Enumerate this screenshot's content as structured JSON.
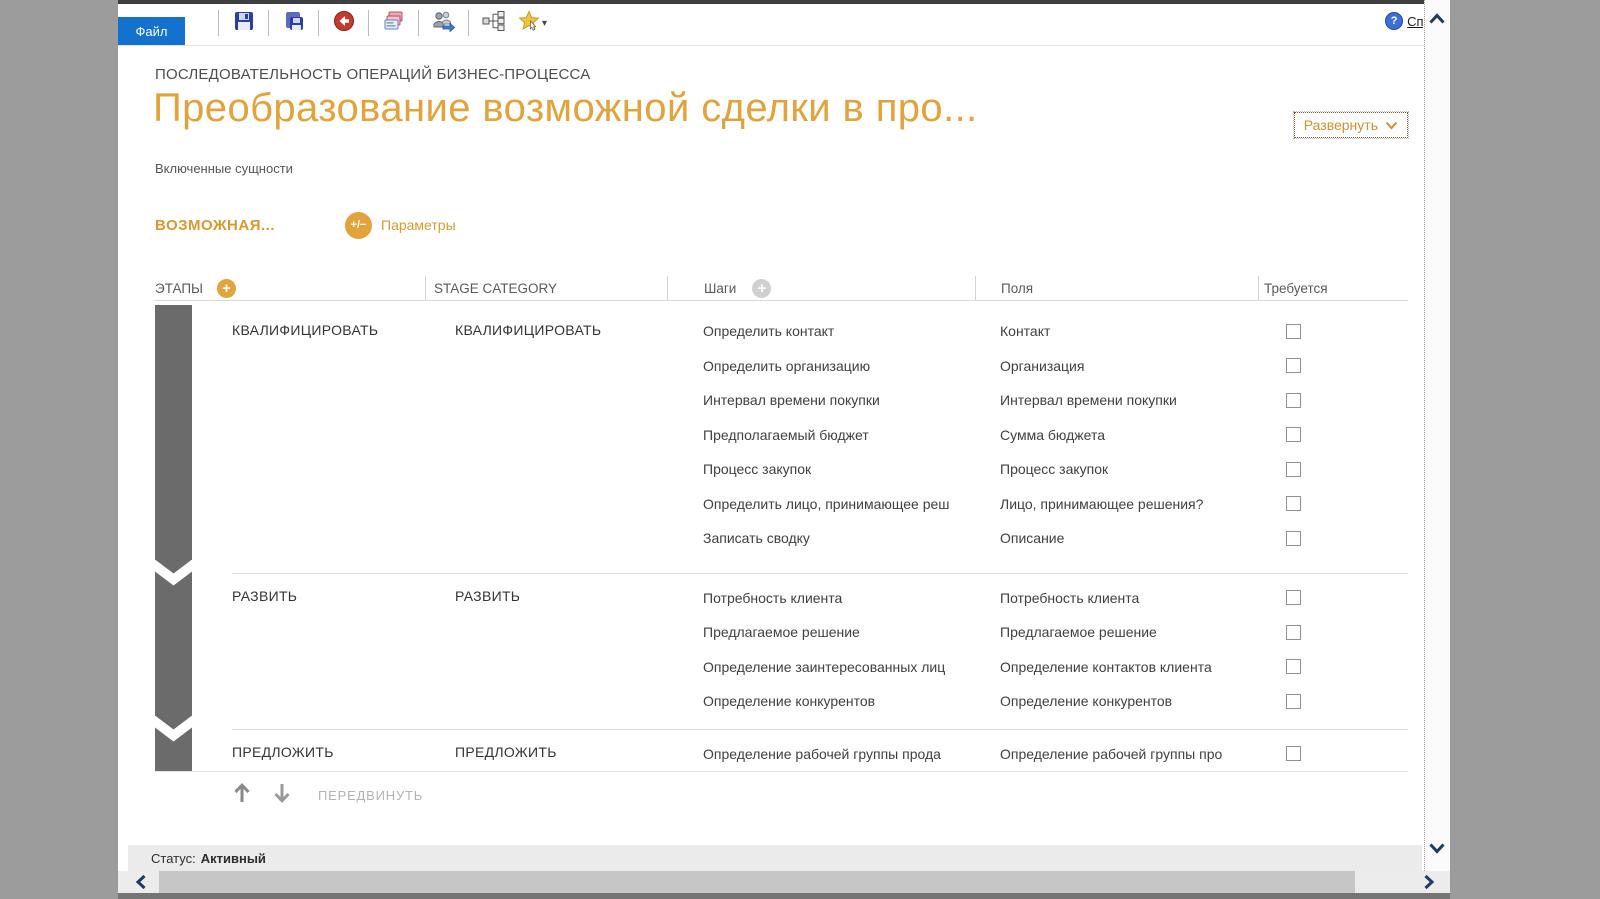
{
  "colors": {
    "accent_orange": "#E2A33C",
    "file_tab_blue": "#1272CE",
    "stage_bar_gray": "#6B6B6B",
    "scroll_chevron_navy": "#1F3A63"
  },
  "glyphs": {
    "plus": "+",
    "question": "?",
    "caret": "▾"
  },
  "toolbar": {
    "file_tab": "Файл",
    "icons": [
      "save-icon",
      "save-and-close-icon",
      "deactivate-icon",
      "copy-icon",
      "assign-icon",
      "workflow-icon",
      "favorites-icon"
    ],
    "help_label": "Спра"
  },
  "header": {
    "caption": "ПОСЛЕДОВАТЕЛЬНОСТЬ ОПЕРАЦИЙ БИЗНЕС-ПРОЦЕССА",
    "title": "Преобразование возможной сделки в про...",
    "expand_label": "Развернуть"
  },
  "entities": {
    "section_label": "Включенные сущности",
    "entity_name": "ВОЗМОЖНАЯ...",
    "params_icon": "+/−",
    "params_label": "Параметры"
  },
  "grid": {
    "headers": {
      "stages": "ЭТАПЫ",
      "stage_category": "STAGE CATEGORY",
      "steps": "Шаги",
      "fields": "Поля",
      "required": "Требуется"
    },
    "stages": [
      {
        "name": "КВАЛИФИЦИРОВАТЬ",
        "category": "КВАЛИФИЦИРОВАТЬ",
        "rows": [
          {
            "step": "Определить контакт",
            "field": "Контакт",
            "required": false
          },
          {
            "step": "Определить организацию",
            "field": "Организация",
            "required": false
          },
          {
            "step": "Интервал времени покупки",
            "field": "Интервал времени покупки",
            "required": false
          },
          {
            "step": "Предполагаемый бюджет",
            "field": "Сумма бюджета",
            "required": false
          },
          {
            "step": "Процесс закупок",
            "field": "Процесс закупок",
            "required": false
          },
          {
            "step": "Определить лицо, принимающее реш",
            "field": "Лицо, принимающее решения?",
            "required": false
          },
          {
            "step": "Записать сводку",
            "field": "Описание",
            "required": false
          }
        ]
      },
      {
        "name": "РАЗВИТЬ",
        "category": "РАЗВИТЬ",
        "rows": [
          {
            "step": "Потребность клиента",
            "field": "Потребность клиента",
            "required": false
          },
          {
            "step": "Предлагаемое решение",
            "field": "Предлагаемое решение",
            "required": false
          },
          {
            "step": "Определение заинтересованных лиц",
            "field": "Определение контактов клиента",
            "required": false
          },
          {
            "step": "Определение конкурентов",
            "field": "Определение конкурентов",
            "required": false
          }
        ]
      },
      {
        "name": "ПРЕДЛОЖИТЬ",
        "category": "ПРЕДЛОЖИТЬ",
        "rows": [
          {
            "step": "Определение рабочей группы прода",
            "field": "Определение рабочей группы про",
            "required": false
          }
        ]
      }
    ]
  },
  "footer": {
    "move_label": "ПЕРЕДВИНУТЬ"
  },
  "statusbar": {
    "label": "Статус:",
    "value": "Активный"
  }
}
